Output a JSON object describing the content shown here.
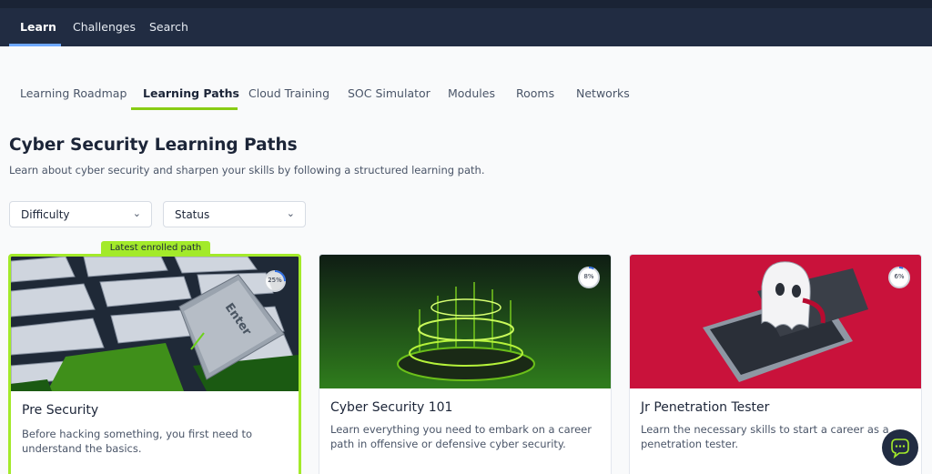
{
  "topnav": {
    "items": [
      "Learn",
      "Challenges",
      "Search"
    ]
  },
  "tabs": [
    "Learning Roadmap",
    "Learning Paths",
    "Cloud Training",
    "SOC Simulator",
    "Modules",
    "Rooms",
    "Networks"
  ],
  "header": {
    "title": "Cyber Security Learning Paths",
    "subtitle": "Learn about cyber security and sharpen your skills by following a structured learning path."
  },
  "filters": {
    "difficulty": "Difficulty",
    "status": "Status"
  },
  "badge": "Latest enrolled path",
  "cards": [
    {
      "title": "Pre Security",
      "desc": "Before hacking something, you first need to understand the basics.",
      "progress": "25%",
      "progress_value": 0.25
    },
    {
      "title": "Cyber Security 101",
      "desc": "Learn everything you need to embark on a career path in offensive or defensive cyber security.",
      "progress": "8%",
      "progress_value": 0.08
    },
    {
      "title": "Jr Penetration Tester",
      "desc": "Learn the necessary skills to start a career as a penetration tester.",
      "progress": "6%",
      "progress_value": 0.06
    }
  ],
  "colors": {
    "accent": "#88cc14",
    "nav_bg": "#212c42",
    "progress": "#2f6fe4"
  },
  "icons": [
    "chevron-down-icon",
    "chat-support-icon"
  ]
}
